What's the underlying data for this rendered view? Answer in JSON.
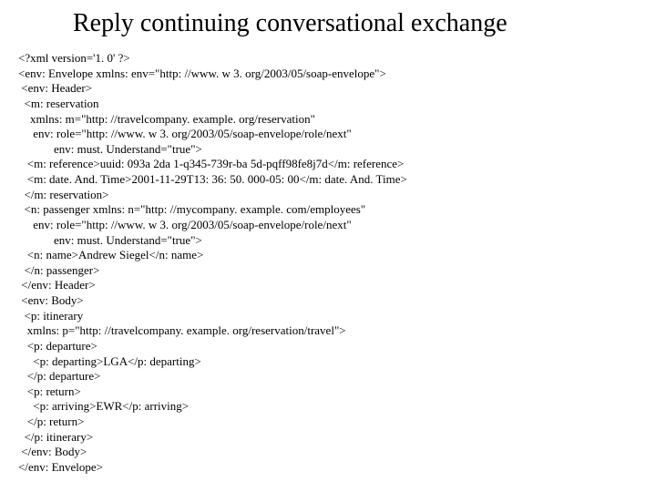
{
  "title": "Reply continuing conversational exchange",
  "code_lines": [
    "<?xml version='1. 0' ?>",
    "<env: Envelope xmlns: env=\"http: //www. w 3. org/2003/05/soap-envelope\">",
    " <env: Header>",
    "  <m: reservation",
    "    xmlns: m=\"http: //travelcompany. example. org/reservation\"",
    "     env: role=\"http: //www. w 3. org/2003/05/soap-envelope/role/next\"",
    "            env: must. Understand=\"true\">",
    "   <m: reference>uuid: 093a 2da 1-q345-739r-ba 5d-pqff98fe8j7d</m: reference>",
    "   <m: date. And. Time>2001-11-29T13: 36: 50. 000-05: 00</m: date. And. Time>",
    "  </m: reservation>",
    "  <n: passenger xmlns: n=\"http: //mycompany. example. com/employees\"",
    "     env: role=\"http: //www. w 3. org/2003/05/soap-envelope/role/next\"",
    "            env: must. Understand=\"true\">",
    "   <n: name>Andrew Siegel</n: name>",
    "  </n: passenger>",
    " </env: Header>",
    " <env: Body>",
    "  <p: itinerary",
    "   xmlns: p=\"http: //travelcompany. example. org/reservation/travel\">",
    "   <p: departure>",
    "     <p: departing>LGA</p: departing>",
    "   </p: departure>",
    "   <p: return>",
    "     <p: arriving>EWR</p: arriving>",
    "   </p: return>",
    "  </p: itinerary>",
    " </env: Body>",
    "</env: Envelope>"
  ]
}
